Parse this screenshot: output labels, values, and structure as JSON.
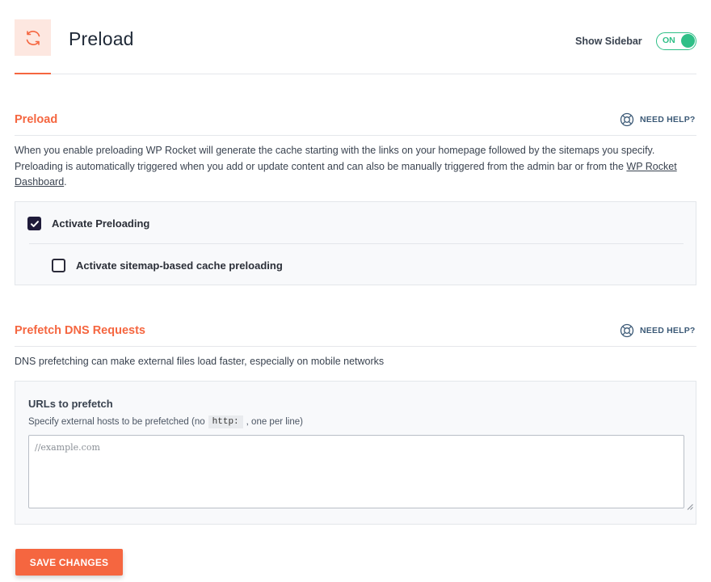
{
  "header": {
    "title": "Preload",
    "sidebar_label": "Show Sidebar",
    "sidebar_toggle": "ON"
  },
  "preload": {
    "title": "Preload",
    "help": "NEED HELP?",
    "description": "When you enable preloading WP Rocket will generate the cache starting with the links on your homepage followed by the sitemaps you specify. Preloading is automatically triggered when you add or update content and can also be manually triggered from the admin bar or from the ",
    "description_link": "WP Rocket Dashboard",
    "description_end": ".",
    "options": [
      {
        "label": "Activate Preloading",
        "checked": true
      },
      {
        "label": "Activate sitemap-based cache preloading",
        "checked": false
      }
    ]
  },
  "prefetch": {
    "title": "Prefetch DNS Requests",
    "help": "NEED HELP?",
    "description": "DNS prefetching can make external files load faster, especially on mobile networks",
    "field_label": "URLs to prefetch",
    "field_desc_before": "Specify external hosts to be prefetched (no",
    "field_desc_code": "http:",
    "field_desc_after": ", one per line)",
    "placeholder": "//example.com",
    "value": ""
  },
  "save_button": "SAVE CHANGES",
  "colors": {
    "accent": "#f56640",
    "toggle": "#2fbf87",
    "checkbox": "#1f1b3a",
    "help_text": "#3c5a77"
  }
}
